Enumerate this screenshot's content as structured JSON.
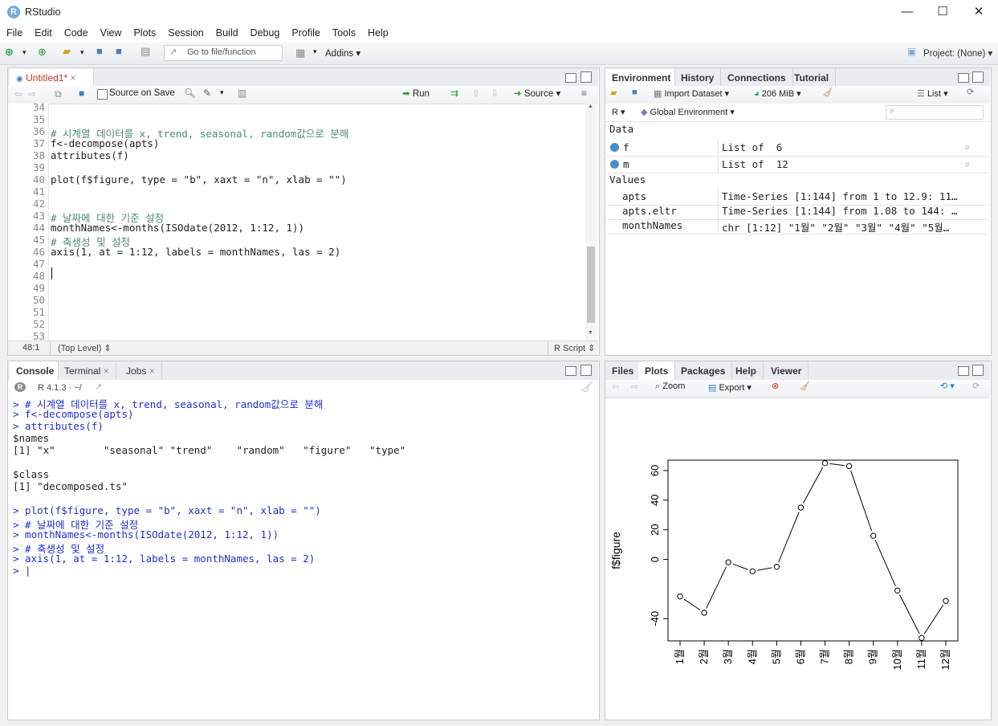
{
  "window": {
    "title": "RStudio",
    "logo_letter": "R",
    "min": "—",
    "max": "☐",
    "close": "✕"
  },
  "menu": [
    "File",
    "Edit",
    "Code",
    "View",
    "Plots",
    "Session",
    "Build",
    "Debug",
    "Profile",
    "Tools",
    "Help"
  ],
  "toolbar": {
    "goto_placeholder": "Go to file/function",
    "addins": "Addins",
    "project": "Project: (None)"
  },
  "editor": {
    "tab": "Untitled1*",
    "source_on_save": "Source on Save",
    "run": "Run",
    "source": "Source",
    "cursor_pos": "48:1",
    "scope": "(Top Level)",
    "filetype": "R Script",
    "lines": [
      {
        "n": "34",
        "t": ""
      },
      {
        "n": "35",
        "t": ""
      },
      {
        "n": "36",
        "t": "# 시계열 데이터를 x, trend, seasonal, random값으로 분해",
        "k": "cmt"
      },
      {
        "n": "37",
        "t": "f<-decompose(apts)"
      },
      {
        "n": "38",
        "t": "attributes(f)"
      },
      {
        "n": "39",
        "t": ""
      },
      {
        "n": "40",
        "t": "plot(f$figure, type = \"b\", xaxt = \"n\", xlab = \"\")"
      },
      {
        "n": "41",
        "t": ""
      },
      {
        "n": "42",
        "t": ""
      },
      {
        "n": "43",
        "t": "# 날짜에 대한 기준 설정",
        "k": "cmt"
      },
      {
        "n": "44",
        "t": "monthNames<-months(ISOdate(2012, 1:12, 1))"
      },
      {
        "n": "45",
        "t": "# 축생성 및 설정",
        "k": "cmt"
      },
      {
        "n": "46",
        "t": "axis(1, at = 1:12, labels = monthNames, las = 2)"
      },
      {
        "n": "47",
        "t": ""
      },
      {
        "n": "48",
        "t": ""
      },
      {
        "n": "49",
        "t": ""
      },
      {
        "n": "50",
        "t": ""
      },
      {
        "n": "51",
        "t": ""
      },
      {
        "n": "52",
        "t": ""
      },
      {
        "n": "53",
        "t": ""
      }
    ]
  },
  "console": {
    "tabs": [
      "Console",
      "Terminal",
      "Jobs"
    ],
    "version": "R 4.1.3 · ~/",
    "lines": [
      {
        "t": "> # 시계열 데이터를 x, trend, seasonal, random값으로 분해",
        "in": true
      },
      {
        "t": "> f<-decompose(apts)",
        "in": true
      },
      {
        "t": "> attributes(f)",
        "in": true
      },
      {
        "t": "$names",
        "in": false
      },
      {
        "t": "[1] \"x\"        \"seasonal\" \"trend\"    \"random\"   \"figure\"   \"type\"",
        "in": false
      },
      {
        "t": "",
        "in": false
      },
      {
        "t": "$class",
        "in": false
      },
      {
        "t": "[1] \"decomposed.ts\"",
        "in": false
      },
      {
        "t": "",
        "in": false
      },
      {
        "t": "> plot(f$figure, type = \"b\", xaxt = \"n\", xlab = \"\")",
        "in": true
      },
      {
        "t": "> # 날짜에 대한 기준 설정",
        "in": true
      },
      {
        "t": "> monthNames<-months(ISOdate(2012, 1:12, 1))",
        "in": true
      },
      {
        "t": "> # 축생성 및 설정",
        "in": true
      },
      {
        "t": "> axis(1, at = 1:12, labels = monthNames, las = 2)",
        "in": true
      },
      {
        "t": "> |",
        "in": true
      }
    ]
  },
  "environment": {
    "tabs": [
      "Environment",
      "History",
      "Connections",
      "Tutorial"
    ],
    "import_dataset": "Import Dataset",
    "memory": "206 MiB",
    "view_mode": "List",
    "lang": "R",
    "scope": "Global Environment",
    "data_header": "Data",
    "values_header": "Values",
    "data": [
      {
        "name": "f",
        "value": "List of  6"
      },
      {
        "name": "m",
        "value": "List of  12"
      }
    ],
    "values": [
      {
        "name": "apts",
        "value": "Time-Series [1:144] from 1 to 12.9: 11…"
      },
      {
        "name": "apts.eltr",
        "value": "Time-Series [1:144] from 1.08 to 144: …"
      },
      {
        "name": "monthNames",
        "value": "chr [1:12] \"1월\" \"2월\" \"3월\" \"4월\" \"5월…"
      }
    ]
  },
  "files": {
    "tabs": [
      "Files",
      "Plots",
      "Packages",
      "Help",
      "Viewer"
    ],
    "zoom": "Zoom",
    "export": "Export"
  },
  "chart_data": {
    "type": "line",
    "title": "",
    "xlabel": "",
    "ylabel": "f$figure",
    "categories": [
      "1월",
      "2월",
      "3월",
      "4월",
      "5월",
      "6월",
      "7월",
      "8월",
      "9월",
      "10월",
      "11월",
      "12월"
    ],
    "values": [
      -25,
      -36,
      -2,
      -8,
      -5,
      35,
      65,
      63,
      16,
      -21,
      -53,
      -28
    ],
    "ylim": [
      -55,
      67
    ],
    "yticks": [
      "-40",
      "0",
      "20",
      "40",
      "60"
    ],
    "grid": false,
    "markers": "open-circle"
  }
}
